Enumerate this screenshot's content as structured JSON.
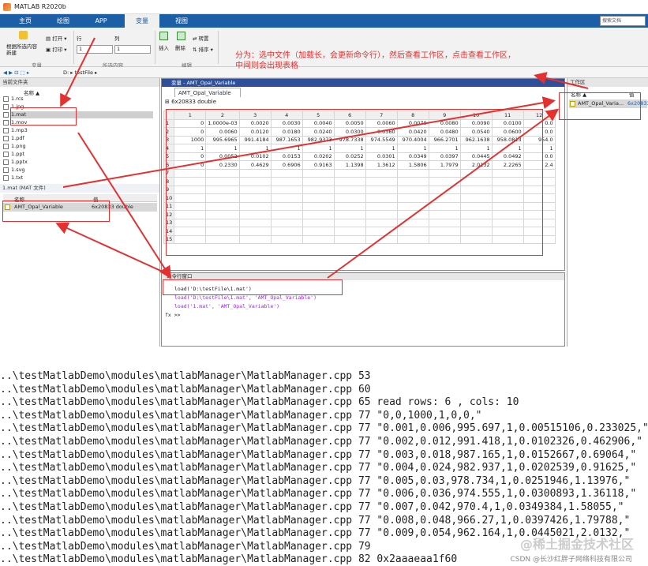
{
  "window": {
    "title": "MATLAB R2020b"
  },
  "tabs": [
    "主页",
    "绘图",
    "APP",
    "变量",
    "视图"
  ],
  "search": {
    "placeholder": "搜索文档"
  },
  "toolstrip": {
    "new_from_sel": "根据所选内容\n新建",
    "open": "打开",
    "print": "打印",
    "row_label": "行",
    "col_label": "列",
    "row_val": "1",
    "col_val": "1",
    "insert": "插入",
    "delete": "删除",
    "transpose": "转置",
    "sort": "排序",
    "groups": [
      "变量",
      "所选内容",
      "编辑"
    ]
  },
  "address": {
    "path": "D: ▸ testFile ▸"
  },
  "left_pane": {
    "title": "当前文件夹",
    "name_header": "名称 ▲",
    "files": [
      "1.rcs",
      "1.jpg",
      "1.mat",
      "1.mov",
      "1.mp3",
      "1.pdf",
      "1.png",
      "1.ppt",
      "1.pptx",
      "1.svg",
      "1.txt"
    ],
    "detail_title": "1.mat  (MAT 文件)",
    "detail_headers": [
      "名称",
      "值"
    ],
    "detail_row": {
      "name": "AMT_Opal_Variable",
      "value": "6x20833 double"
    }
  },
  "var_editor": {
    "title": "变量 - AMT_Opal_Variable",
    "tab": "AMT_Opal_Variable",
    "size": "6x20833 double",
    "col_headers": [
      "1",
      "2",
      "3",
      "4",
      "5",
      "6",
      "7",
      "8",
      "9",
      "10",
      "11",
      "12"
    ],
    "rows": [
      [
        "0",
        "1.0000e-03",
        "0.0020",
        "0.0030",
        "0.0040",
        "0.0050",
        "0.0060",
        "0.0070",
        "0.0080",
        "0.0090",
        "0.0100",
        "0.0"
      ],
      [
        "0",
        "0.0060",
        "0.0120",
        "0.0180",
        "0.0240",
        "0.0300",
        "0.0360",
        "0.0420",
        "0.0480",
        "0.0540",
        "0.0600",
        "0.0"
      ],
      [
        "1000",
        "995.6965",
        "991.4184",
        "987.1653",
        "982.9373",
        "978.7338",
        "974.5549",
        "970.4004",
        "966.2701",
        "962.1638",
        "958.0813",
        "954.0"
      ],
      [
        "1",
        "1",
        "1",
        "1",
        "1",
        "1",
        "1",
        "1",
        "1",
        "1",
        "1",
        "1"
      ],
      [
        "0",
        "0.0052",
        "0.0102",
        "0.0153",
        "0.0202",
        "0.0252",
        "0.0301",
        "0.0349",
        "0.0397",
        "0.0445",
        "0.0492",
        "0.0"
      ],
      [
        "0",
        "0.2330",
        "0.4629",
        "0.6906",
        "0.9163",
        "1.1398",
        "1.3612",
        "1.5806",
        "1.7979",
        "2.0132",
        "2.2265",
        "2.4"
      ]
    ],
    "row_count": 15
  },
  "command_window": {
    "title": "命令行窗口",
    "lines": [
      "load('D:\\testFile\\1.mat')",
      "load('D:\\testFile\\1.mat', 'AMT_Opal_Variable')",
      "load('1.mat', 'AMT_Opal_Variable')"
    ],
    "prompt": "fx >>"
  },
  "workspace": {
    "title": "工作区",
    "headers": [
      "名称 ▲",
      "值"
    ],
    "item": "AMT_Opal_Varia...",
    "value": "6x20833"
  },
  "annotation": {
    "text": "分为：选中文件（加载长，会更新命令行），然后查看工作区，点击查看工作区，\n中间则会出现表格"
  },
  "console_lines": [
    "..\\testMatlabDemo\\modules\\matlabManager\\MatlabManager.cpp 53",
    "..\\testMatlabDemo\\modules\\matlabManager\\MatlabManager.cpp 60",
    "..\\testMatlabDemo\\modules\\matlabManager\\MatlabManager.cpp 65 read rows: 6 , cols: 10",
    "..\\testMatlabDemo\\modules\\matlabManager\\MatlabManager.cpp 77 \"0,0,1000,1,0,0,\"",
    "..\\testMatlabDemo\\modules\\matlabManager\\MatlabManager.cpp 77 \"0.001,0.006,995.697,1,0.00515106,0.233025,\"",
    "..\\testMatlabDemo\\modules\\matlabManager\\MatlabManager.cpp 77 \"0.002,0.012,991.418,1,0.0102326,0.462906,\"",
    "..\\testMatlabDemo\\modules\\matlabManager\\MatlabManager.cpp 77 \"0.003,0.018,987.165,1,0.0152667,0.69064,\"",
    "..\\testMatlabDemo\\modules\\matlabManager\\MatlabManager.cpp 77 \"0.004,0.024,982.937,1,0.0202539,0.91625,\"",
    "..\\testMatlabDemo\\modules\\matlabManager\\MatlabManager.cpp 77 \"0.005,0.03,978.734,1,0.0251946,1.13976,\"",
    "..\\testMatlabDemo\\modules\\matlabManager\\MatlabManager.cpp 77 \"0.006,0.036,974.555,1,0.0300893,1.36118,\"",
    "..\\testMatlabDemo\\modules\\matlabManager\\MatlabManager.cpp 77 \"0.007,0.042,970.4,1,0.0349384,1.58055,\"",
    "..\\testMatlabDemo\\modules\\matlabManager\\MatlabManager.cpp 77 \"0.008,0.048,966.27,1,0.0397426,1.79788,\"",
    "..\\testMatlabDemo\\modules\\matlabManager\\MatlabManager.cpp 77 \"0.009,0.054,962.164,1,0.0445021,2.0132,\"",
    "..\\testMatlabDemo\\modules\\matlabManager\\MatlabManager.cpp 79",
    "..\\testMatlabDemo\\modules\\matlabManager\\MatlabManager.cpp 82 0x2aaaeaa1f60"
  ],
  "watermark": {
    "site": "@稀土掘金技术社区",
    "csdn": "CSDN @长沙红胖子网络科技有限公司"
  }
}
